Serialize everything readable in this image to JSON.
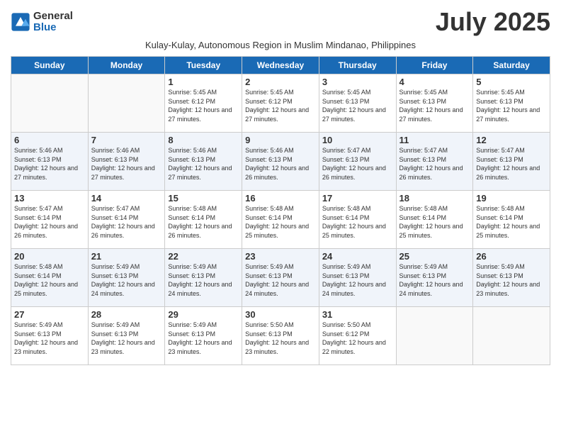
{
  "header": {
    "logo_general": "General",
    "logo_blue": "Blue",
    "month_title": "July 2025",
    "subtitle": "Kulay-Kulay, Autonomous Region in Muslim Mindanao, Philippines"
  },
  "weekdays": [
    "Sunday",
    "Monday",
    "Tuesday",
    "Wednesday",
    "Thursday",
    "Friday",
    "Saturday"
  ],
  "weeks": [
    [
      {
        "day": "",
        "info": ""
      },
      {
        "day": "",
        "info": ""
      },
      {
        "day": "1",
        "info": "Sunrise: 5:45 AM\nSunset: 6:12 PM\nDaylight: 12 hours and 27 minutes."
      },
      {
        "day": "2",
        "info": "Sunrise: 5:45 AM\nSunset: 6:12 PM\nDaylight: 12 hours and 27 minutes."
      },
      {
        "day": "3",
        "info": "Sunrise: 5:45 AM\nSunset: 6:13 PM\nDaylight: 12 hours and 27 minutes."
      },
      {
        "day": "4",
        "info": "Sunrise: 5:45 AM\nSunset: 6:13 PM\nDaylight: 12 hours and 27 minutes."
      },
      {
        "day": "5",
        "info": "Sunrise: 5:45 AM\nSunset: 6:13 PM\nDaylight: 12 hours and 27 minutes."
      }
    ],
    [
      {
        "day": "6",
        "info": "Sunrise: 5:46 AM\nSunset: 6:13 PM\nDaylight: 12 hours and 27 minutes."
      },
      {
        "day": "7",
        "info": "Sunrise: 5:46 AM\nSunset: 6:13 PM\nDaylight: 12 hours and 27 minutes."
      },
      {
        "day": "8",
        "info": "Sunrise: 5:46 AM\nSunset: 6:13 PM\nDaylight: 12 hours and 27 minutes."
      },
      {
        "day": "9",
        "info": "Sunrise: 5:46 AM\nSunset: 6:13 PM\nDaylight: 12 hours and 26 minutes."
      },
      {
        "day": "10",
        "info": "Sunrise: 5:47 AM\nSunset: 6:13 PM\nDaylight: 12 hours and 26 minutes."
      },
      {
        "day": "11",
        "info": "Sunrise: 5:47 AM\nSunset: 6:13 PM\nDaylight: 12 hours and 26 minutes."
      },
      {
        "day": "12",
        "info": "Sunrise: 5:47 AM\nSunset: 6:13 PM\nDaylight: 12 hours and 26 minutes."
      }
    ],
    [
      {
        "day": "13",
        "info": "Sunrise: 5:47 AM\nSunset: 6:14 PM\nDaylight: 12 hours and 26 minutes."
      },
      {
        "day": "14",
        "info": "Sunrise: 5:47 AM\nSunset: 6:14 PM\nDaylight: 12 hours and 26 minutes."
      },
      {
        "day": "15",
        "info": "Sunrise: 5:48 AM\nSunset: 6:14 PM\nDaylight: 12 hours and 26 minutes."
      },
      {
        "day": "16",
        "info": "Sunrise: 5:48 AM\nSunset: 6:14 PM\nDaylight: 12 hours and 25 minutes."
      },
      {
        "day": "17",
        "info": "Sunrise: 5:48 AM\nSunset: 6:14 PM\nDaylight: 12 hours and 25 minutes."
      },
      {
        "day": "18",
        "info": "Sunrise: 5:48 AM\nSunset: 6:14 PM\nDaylight: 12 hours and 25 minutes."
      },
      {
        "day": "19",
        "info": "Sunrise: 5:48 AM\nSunset: 6:14 PM\nDaylight: 12 hours and 25 minutes."
      }
    ],
    [
      {
        "day": "20",
        "info": "Sunrise: 5:48 AM\nSunset: 6:14 PM\nDaylight: 12 hours and 25 minutes."
      },
      {
        "day": "21",
        "info": "Sunrise: 5:49 AM\nSunset: 6:13 PM\nDaylight: 12 hours and 24 minutes."
      },
      {
        "day": "22",
        "info": "Sunrise: 5:49 AM\nSunset: 6:13 PM\nDaylight: 12 hours and 24 minutes."
      },
      {
        "day": "23",
        "info": "Sunrise: 5:49 AM\nSunset: 6:13 PM\nDaylight: 12 hours and 24 minutes."
      },
      {
        "day": "24",
        "info": "Sunrise: 5:49 AM\nSunset: 6:13 PM\nDaylight: 12 hours and 24 minutes."
      },
      {
        "day": "25",
        "info": "Sunrise: 5:49 AM\nSunset: 6:13 PM\nDaylight: 12 hours and 24 minutes."
      },
      {
        "day": "26",
        "info": "Sunrise: 5:49 AM\nSunset: 6:13 PM\nDaylight: 12 hours and 23 minutes."
      }
    ],
    [
      {
        "day": "27",
        "info": "Sunrise: 5:49 AM\nSunset: 6:13 PM\nDaylight: 12 hours and 23 minutes."
      },
      {
        "day": "28",
        "info": "Sunrise: 5:49 AM\nSunset: 6:13 PM\nDaylight: 12 hours and 23 minutes."
      },
      {
        "day": "29",
        "info": "Sunrise: 5:49 AM\nSunset: 6:13 PM\nDaylight: 12 hours and 23 minutes."
      },
      {
        "day": "30",
        "info": "Sunrise: 5:50 AM\nSunset: 6:13 PM\nDaylight: 12 hours and 23 minutes."
      },
      {
        "day": "31",
        "info": "Sunrise: 5:50 AM\nSunset: 6:12 PM\nDaylight: 12 hours and 22 minutes."
      },
      {
        "day": "",
        "info": ""
      },
      {
        "day": "",
        "info": ""
      }
    ]
  ]
}
